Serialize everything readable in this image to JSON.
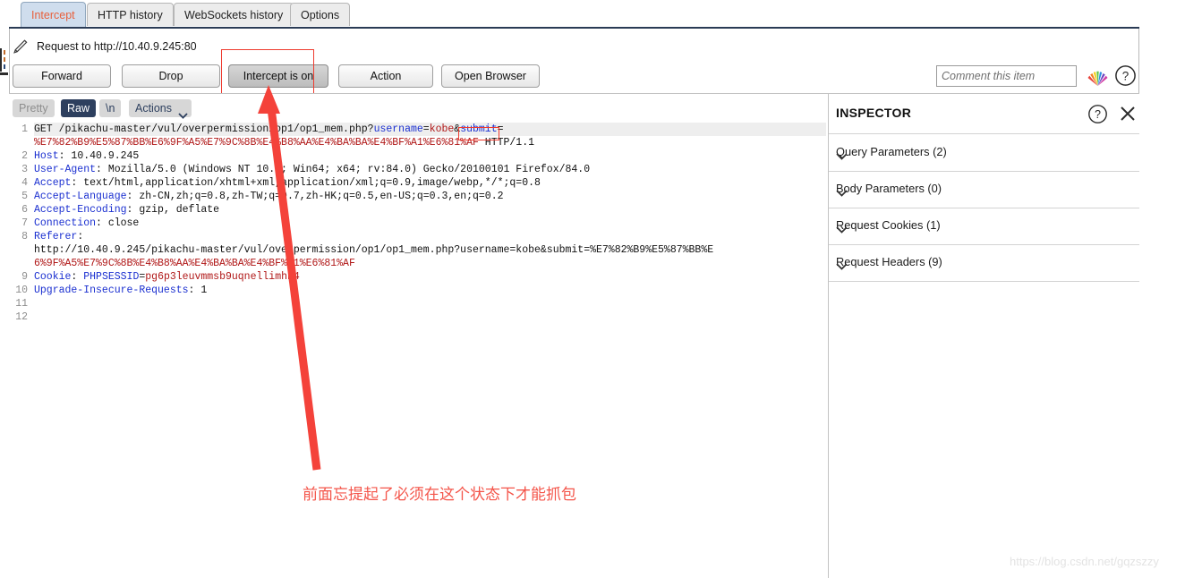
{
  "tabs": [
    {
      "label": "Intercept",
      "active": true
    },
    {
      "label": "HTTP history",
      "active": false
    },
    {
      "label": "WebSockets history",
      "active": false
    },
    {
      "label": "Options",
      "active": false
    }
  ],
  "request_bar": {
    "icon": "pencil-icon",
    "title": "Request to http://10.40.9.245:80"
  },
  "buttons": [
    {
      "label": "Forward",
      "pressed": false
    },
    {
      "label": "Drop",
      "pressed": false
    },
    {
      "label": "Intercept is on",
      "pressed": true
    },
    {
      "label": "Action",
      "pressed": false
    },
    {
      "label": "Open Browser",
      "pressed": false
    }
  ],
  "comment": {
    "value": "",
    "placeholder": "Comment this item"
  },
  "top_icons": [
    {
      "name": "highlighter-colors-icon"
    },
    {
      "name": "help-circle-icon"
    }
  ],
  "format_toolbar": {
    "pretty": "Pretty",
    "raw": "Raw",
    "newline": "\\n",
    "actions": "Actions",
    "active": "Raw"
  },
  "editor": {
    "gutter": [
      "1",
      "",
      "2",
      "3",
      "4",
      "5",
      "6",
      "7",
      "8",
      "",
      "",
      "9",
      "10",
      "11",
      "12"
    ],
    "lines": [
      {
        "num": "1",
        "highlight": true,
        "parts": [
          {
            "t": "GET /pikachu-master/vul/overpermission/op1/op1_mem.php?",
            "c": "b"
          },
          {
            "t": "username",
            "c": "k"
          },
          {
            "t": "=",
            "c": "b"
          },
          {
            "t": "kobe",
            "c": "r"
          },
          {
            "t": "&",
            "c": "b"
          },
          {
            "t": "submit",
            "c": "k"
          },
          {
            "t": "=",
            "c": "b"
          }
        ]
      },
      {
        "num": "",
        "highlight": false,
        "parts": [
          {
            "t": "%E7%82%B9%E5%87%BB%E6%9F%A5%E7%9C%8B%E4%B8%AA%E4%BA%BA%E4%BF%A1%E6%81%AF",
            "c": "r"
          },
          {
            "t": " HTTP/1.1",
            "c": "b"
          }
        ]
      },
      {
        "num": "2",
        "highlight": false,
        "parts": [
          {
            "t": "Host",
            "c": "k"
          },
          {
            "t": ": 10.40.9.245",
            "c": "b"
          }
        ]
      },
      {
        "num": "3",
        "highlight": false,
        "parts": [
          {
            "t": "User-Agent",
            "c": "k"
          },
          {
            "t": ": Mozilla/5.0 (Windows NT 10.0; Win64; x64; rv:84.0) Gecko/20100101 Firefox/84.0",
            "c": "b"
          }
        ]
      },
      {
        "num": "4",
        "highlight": false,
        "parts": [
          {
            "t": "Accept",
            "c": "k"
          },
          {
            "t": ": text/html,application/xhtml+xml,application/xml;q=0.9,image/webp,*/*;q=0.8",
            "c": "b"
          }
        ]
      },
      {
        "num": "5",
        "highlight": false,
        "parts": [
          {
            "t": "Accept-Language",
            "c": "k"
          },
          {
            "t": ": zh-CN,zh;q=0.8,zh-TW;q=0.7,zh-HK;q=0.5,en-US;q=0.3,en;q=0.2",
            "c": "b"
          }
        ]
      },
      {
        "num": "6",
        "highlight": false,
        "parts": [
          {
            "t": "Accept-Encoding",
            "c": "k"
          },
          {
            "t": ": gzip, deflate",
            "c": "b"
          }
        ]
      },
      {
        "num": "7",
        "highlight": false,
        "parts": [
          {
            "t": "Connection",
            "c": "k"
          },
          {
            "t": ": close",
            "c": "b"
          }
        ]
      },
      {
        "num": "8",
        "highlight": false,
        "parts": [
          {
            "t": "Referer",
            "c": "k"
          },
          {
            "t": ":",
            "c": "b"
          }
        ]
      },
      {
        "num": "",
        "highlight": false,
        "parts": [
          {
            "t": "http://10.40.9.245/pikachu-master/vul/overpermission/op1/op1_mem.php?username=kobe&submit=%E7%82%B9%E5%87%BB%E",
            "c": "b"
          }
        ]
      },
      {
        "num": "",
        "highlight": false,
        "parts": [
          {
            "t": "6%9F%A5%E7%9C%8B%E4%B8%AA%E4%BA%BA%E4%BF%A1%E6%81%AF",
            "c": "r"
          }
        ]
      },
      {
        "num": "9",
        "highlight": false,
        "parts": [
          {
            "t": "Cookie",
            "c": "k"
          },
          {
            "t": ": ",
            "c": "b"
          },
          {
            "t": "PHPSESSID",
            "c": "k"
          },
          {
            "t": "=",
            "c": "b"
          },
          {
            "t": "pg6p3leuvmmsb9uqnellimhn4",
            "c": "r"
          }
        ]
      },
      {
        "num": "10",
        "highlight": false,
        "parts": [
          {
            "t": "Upgrade-Insecure-Requests",
            "c": "k"
          },
          {
            "t": ": 1",
            "c": "b"
          }
        ]
      },
      {
        "num": "11",
        "highlight": false,
        "parts": [
          {
            "t": "",
            "c": "b"
          }
        ]
      },
      {
        "num": "12",
        "highlight": false,
        "parts": [
          {
            "t": "",
            "c": "b"
          }
        ]
      }
    ]
  },
  "inspector": {
    "title": "INSPECTOR",
    "help_icon": "help-circle-icon",
    "close_icon": "close-icon",
    "rows": [
      {
        "label": "Query Parameters (2)"
      },
      {
        "label": "Body Parameters (0)"
      },
      {
        "label": "Request Cookies (1)"
      },
      {
        "label": "Request Headers (9)"
      }
    ]
  },
  "annotation": {
    "note": "前面忘提起了必须在这个状态下才能抓包",
    "color": "#f4554a"
  },
  "watermark": {
    "text": "https://blog.csdn.net/gqzszzy"
  },
  "colors": {
    "accent_tab": "#e8603c",
    "active_tab_bg": "#cfdded",
    "raw_pill_bg": "#2d3f5e",
    "annotation_red": "#ee3b2f",
    "key_blue": "#1a2fd0",
    "value_red": "#b01717"
  }
}
